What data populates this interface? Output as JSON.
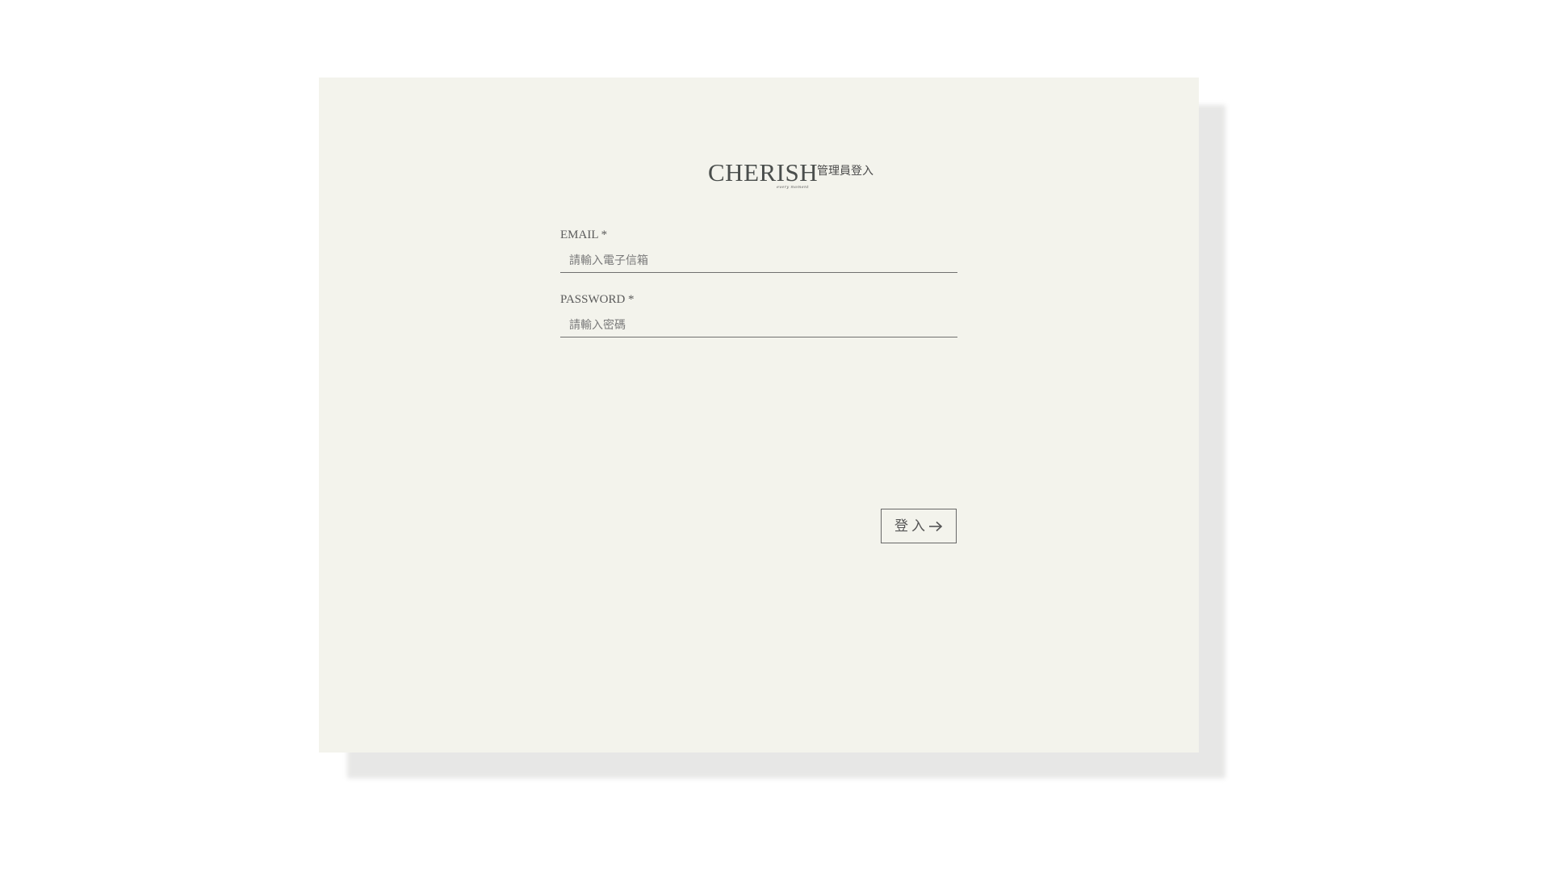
{
  "brand": {
    "logo": "CHERISH",
    "tagline": "every moment",
    "title": "管理員登入"
  },
  "form": {
    "email": {
      "label": "EMAIL *",
      "placeholder": "請輸入電子信箱",
      "value": ""
    },
    "password": {
      "label": "PASSWORD *",
      "placeholder": "請輸入密碼",
      "value": ""
    },
    "submit": {
      "label": "登入",
      "icon": "arrow-right-icon"
    }
  },
  "colors": {
    "card_background": "#f3f3ec",
    "text": "#4a4a4a",
    "border": "#6f6f6f"
  }
}
